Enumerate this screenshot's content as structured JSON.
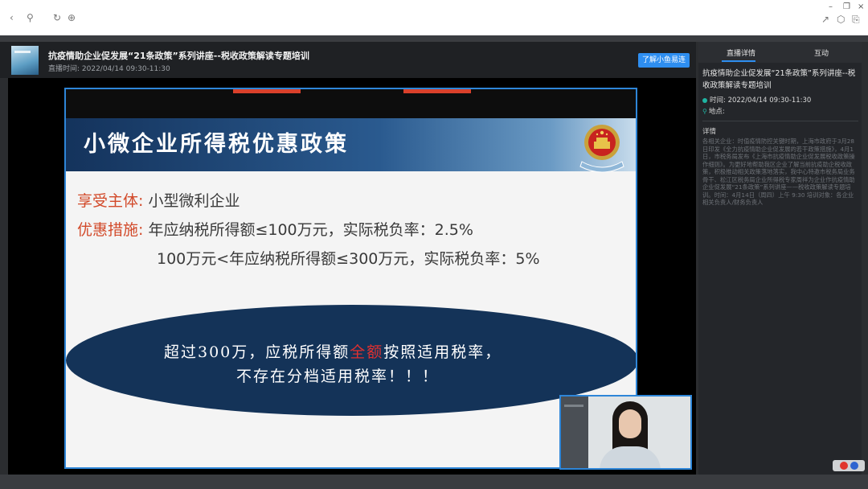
{
  "browser": {
    "back_icon": "‹",
    "link_icon": "⚲",
    "refresh_icon": "↻",
    "globe_icon": "⊕",
    "share_icon": "↗",
    "cube_icon": "⬡",
    "clip_icon": "⎘",
    "minimize": "–",
    "restore": "❐",
    "close": "×"
  },
  "header": {
    "title": "抗疫情助企业促发展“21条政策”系列讲座--税收政策解读专题培训",
    "time": "直播时间: 2022/04/14 09:30-11:30",
    "button": "了解小鱼易连"
  },
  "slide": {
    "title": "小微企业所得税优惠政策",
    "line1_label": "享受主体:",
    "line1_value": "小型微利企业",
    "line2_label": "优惠措施:",
    "line2_value": "年应纳税所得额≤100万元，实际税负率：2.5%",
    "line3_value": "100万元<年应纳税所得额≤300万元，实际税负率：5%",
    "ellipse_part1": "超过300万，应税所得额",
    "ellipse_highlight": "全额",
    "ellipse_part2": "按照适用税率，",
    "ellipse_line2": "不存在分档适用税率！！！"
  },
  "sidebar": {
    "tab_details": "直播详情",
    "tab_interact": "互动",
    "title": "抗疫情助企业促发展“21条政策”系列讲座--税收政策解读专题培训",
    "time": "时间: 2022/04/14 09:30-11:30",
    "location": "地点:",
    "detail_heading": "详情",
    "detail_text": "各相关企业：时值疫情防控关键时期，上海市政府于3月28日印发《全力抗疫情助企业促发展的若干政策措施》，4月1日，市税务局发布《上海市抗疫情助企业促发展税收政策操作细则》。为更好地帮助我区企业了解当前抗疫助企税收政策，积极推动相关政策落地落实，我中心特邀市税务局业务骨干、松江区税务局企业所得税专家周祥为企业作抗疫情助企业促发展“21条政策”系列讲座——税收政策解读专题培训。时间：4月14日（周四）上午 9:30 培训对象：各企业相关负责人/财务负责人"
  },
  "colors": {
    "accent": "#2e8ef0",
    "slide_red": "#d24a2a",
    "ellipse_blue": "#143358",
    "sidebar_dot": "#1fb5a3"
  }
}
